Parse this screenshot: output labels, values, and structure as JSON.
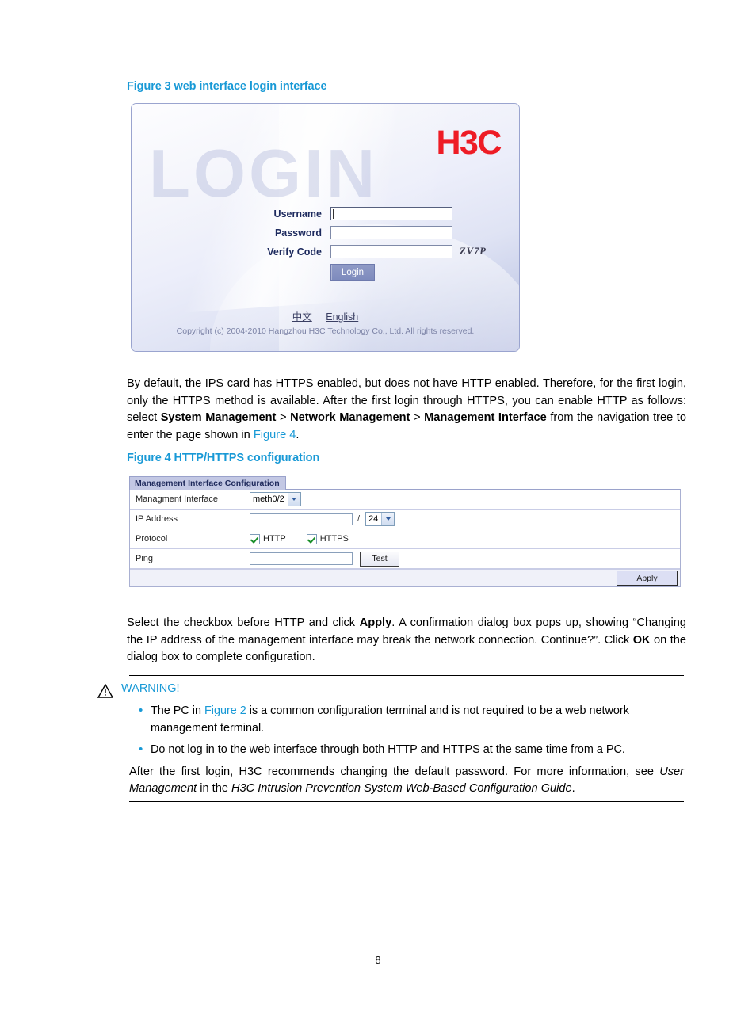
{
  "figure3": {
    "caption": "Figure 3 web interface login interface",
    "watermark": "LOGIN",
    "logo": "H3C",
    "logo_color": "#ee1c25",
    "fields": [
      {
        "label": "Username",
        "value": "",
        "placeholder": ""
      },
      {
        "label": "Password",
        "value": "",
        "placeholder": ""
      },
      {
        "label": "Verify Code",
        "value": "",
        "placeholder": ""
      }
    ],
    "verify_code_image_text": "ZV7P",
    "login_button": "Login",
    "languages": [
      {
        "label": "中文"
      },
      {
        "label": "English"
      }
    ],
    "copyright": "Copyright (c) 2004-2010 Hangzhou H3C Technology Co., Ltd. All rights reserved."
  },
  "para1": {
    "seg1": "By default, the IPS card has HTTPS enabled, but does not have HTTP enabled. Therefore, for the first login, only the HTTPS method is available. After the first login through HTTPS, you can enable HTTP as follows: select ",
    "nav1": "System Management",
    "sep1": " > ",
    "nav2": "Network Management",
    "sep2": " > ",
    "nav3": "Management Interface",
    "seg2": " from the navigation tree to enter the page shown in ",
    "xref": "Figure 4",
    "seg3": "."
  },
  "figure4": {
    "caption": "Figure 4 HTTP/HTTPS configuration",
    "tab_title": "Management Interface Configuration",
    "rows": [
      {
        "label": "Managment Interface",
        "type": "select",
        "value": "meth0/2"
      },
      {
        "label": "IP Address",
        "type": "ip",
        "value": "",
        "separator": "/",
        "mask": "24"
      },
      {
        "label": "Protocol",
        "type": "checkboxes",
        "options": [
          {
            "label": "HTTP",
            "checked": true
          },
          {
            "label": "HTTPS",
            "checked": true
          }
        ]
      },
      {
        "label": "Ping",
        "type": "text_with_button",
        "value": "",
        "button": "Test"
      }
    ],
    "apply_button": "Apply"
  },
  "para2": {
    "seg1": "Select the checkbox before HTTP and click ",
    "bold1": "Apply",
    "seg2": ". A confirmation dialog box pops up, showing “Changing the IP address of the management interface may break the network connection. Continue?”. Click ",
    "bold2": "OK",
    "seg3": " on the dialog box to complete configuration."
  },
  "warning": {
    "title": "WARNING!",
    "accent_color": "#1899d6",
    "bullets": [
      {
        "seg1": "The PC in ",
        "xref": "Figure 2",
        "seg2": " is a common configuration terminal and is not required to be a web network management terminal."
      },
      {
        "seg1": "Do not log in to the web interface through both HTTP and HTTPS at the same time from a PC.",
        "xref": "",
        "seg2": ""
      }
    ],
    "final_para": {
      "seg1": "After the first login, H3C recommends changing the default password. For more information, see ",
      "italic1": "User Management",
      "seg2": " in the ",
      "italic2": "H3C Intrusion Prevention System Web-Based Configuration Guide",
      "seg3": "."
    }
  },
  "page_number": "8"
}
